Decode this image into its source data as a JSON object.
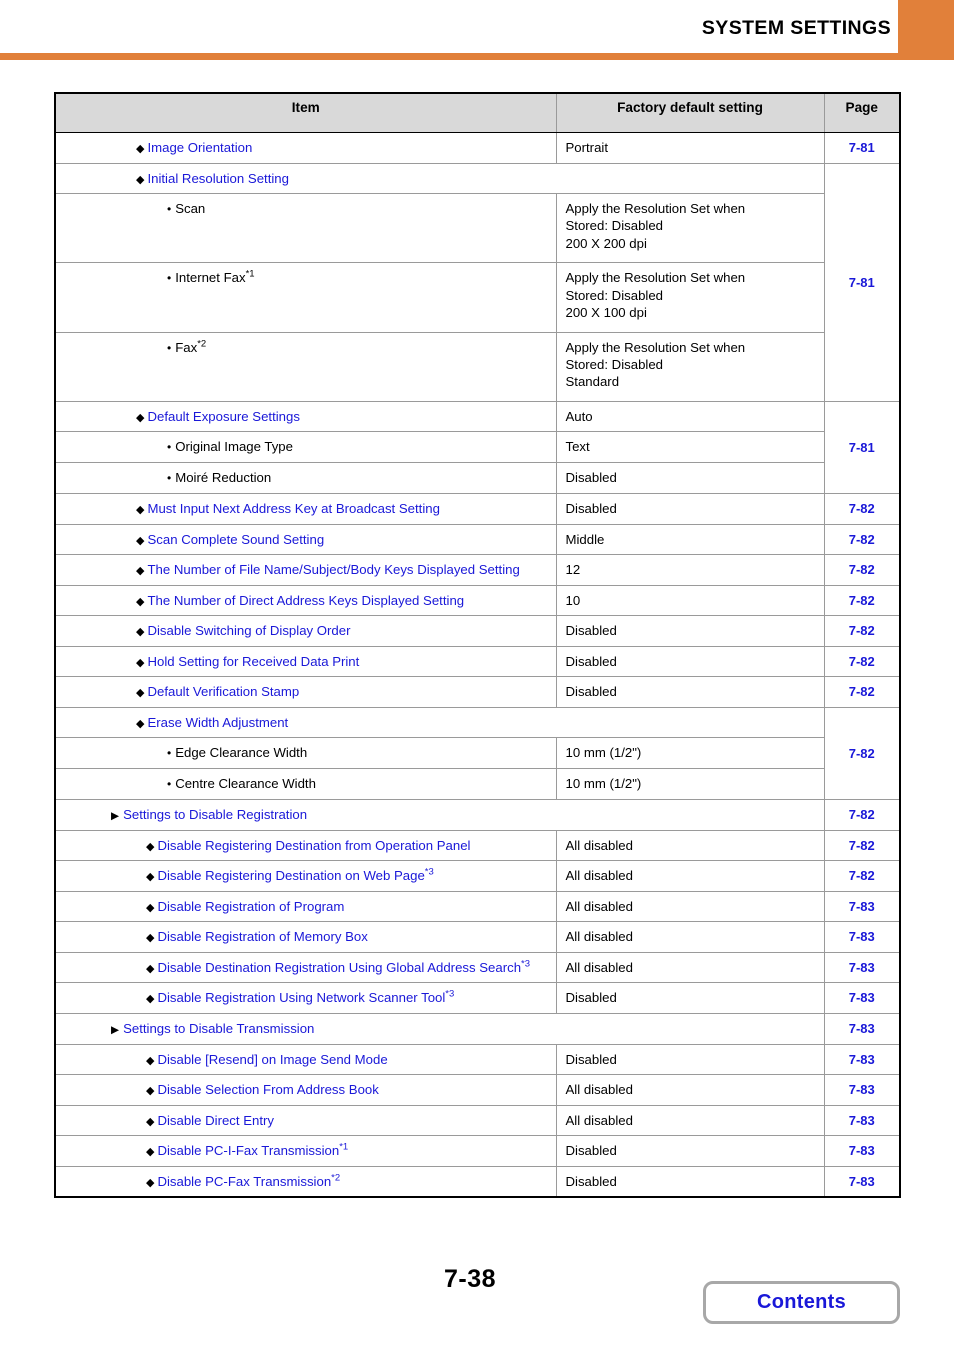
{
  "header": {
    "title": "SYSTEM SETTINGS",
    "accent_color": "#e1803a"
  },
  "table": {
    "columns": {
      "item": "Item",
      "factory_default": "Factory default setting",
      "page": "Page"
    },
    "link_color": "#1a18d8",
    "header_bg": "#d9d9d9",
    "rows": [
      {
        "level": "diamond",
        "label": "Image Orientation",
        "link": true,
        "default": [
          "Portrait"
        ],
        "page": "7-81"
      },
      {
        "level": "diamond",
        "label": "Initial Resolution Setting",
        "link": true,
        "spans_default": true,
        "default": [],
        "page": "7-81",
        "page_rowspan": 4
      },
      {
        "level": "bullet",
        "label": "Scan",
        "link": false,
        "default": [
          "Apply the Resolution Set when",
          "Stored: Disabled",
          "200 X 200 dpi"
        ],
        "page": null
      },
      {
        "level": "bullet",
        "label": "Internet Fax",
        "footnote": "*1",
        "link": false,
        "default": [
          "Apply the Resolution Set when",
          "Stored: Disabled",
          "200 X 100 dpi"
        ],
        "page": null
      },
      {
        "level": "bullet",
        "label": "Fax",
        "footnote": "*2",
        "link": false,
        "default": [
          "Apply the Resolution Set when",
          "Stored: Disabled",
          "Standard"
        ],
        "page": null
      },
      {
        "level": "diamond",
        "label": "Default Exposure Settings",
        "link": true,
        "default": [
          "Auto"
        ],
        "page": "7-81",
        "page_rowspan": 3
      },
      {
        "level": "bullet",
        "label": "Original Image Type",
        "link": false,
        "default": [
          "Text"
        ],
        "page": null
      },
      {
        "level": "bullet",
        "label": "Moiré Reduction",
        "link": false,
        "default": [
          "Disabled"
        ],
        "page": null
      },
      {
        "level": "diamond",
        "label": "Must Input Next Address Key at Broadcast Setting",
        "link": true,
        "default": [
          "Disabled"
        ],
        "page": "7-82"
      },
      {
        "level": "diamond",
        "label": "Scan Complete Sound Setting",
        "link": true,
        "default": [
          "Middle"
        ],
        "page": "7-82"
      },
      {
        "level": "diamond",
        "label": "The Number of File Name/Subject/Body Keys Displayed Setting",
        "link": true,
        "default": [
          "12"
        ],
        "page": "7-82"
      },
      {
        "level": "diamond",
        "label": "The Number of Direct Address Keys Displayed Setting",
        "link": true,
        "default": [
          "10"
        ],
        "page": "7-82"
      },
      {
        "level": "diamond",
        "label": "Disable Switching of Display Order",
        "link": true,
        "default": [
          "Disabled"
        ],
        "page": "7-82"
      },
      {
        "level": "diamond",
        "label": "Hold Setting for Received Data Print",
        "link": true,
        "default": [
          "Disabled"
        ],
        "page": "7-82"
      },
      {
        "level": "diamond",
        "label": "Default Verification Stamp",
        "link": true,
        "default": [
          "Disabled"
        ],
        "page": "7-82"
      },
      {
        "level": "diamond",
        "label": "Erase Width Adjustment",
        "link": true,
        "spans_default": true,
        "default": [],
        "page": "7-82",
        "page_rowspan": 3
      },
      {
        "level": "bullet",
        "label": "Edge Clearance Width",
        "link": false,
        "default": [
          "10 mm (1/2\")"
        ],
        "page": null
      },
      {
        "level": "bullet",
        "label": "Centre Clearance Width",
        "link": false,
        "default": [
          "10 mm (1/2\")"
        ],
        "page": null
      },
      {
        "level": "arrow",
        "label": "Settings to Disable Registration",
        "link": true,
        "spans_default": true,
        "default": [],
        "page": "7-82"
      },
      {
        "level": "diamond2",
        "label": "Disable Registering Destination from Operation Panel",
        "link": true,
        "default": [
          "All disabled"
        ],
        "page": "7-82"
      },
      {
        "level": "diamond2",
        "label": "Disable Registering Destination on Web Page",
        "footnote": "*3",
        "link": true,
        "default": [
          "All disabled"
        ],
        "page": "7-82"
      },
      {
        "level": "diamond2",
        "label": "Disable Registration of Program",
        "link": true,
        "default": [
          "All disabled"
        ],
        "page": "7-83"
      },
      {
        "level": "diamond2",
        "label": "Disable Registration of Memory Box",
        "link": true,
        "default": [
          "All disabled"
        ],
        "page": "7-83"
      },
      {
        "level": "diamond2",
        "label": "Disable Destination Registration Using Global Address Search",
        "footnote": "*3",
        "link": true,
        "default": [
          "All disabled"
        ],
        "page": "7-83"
      },
      {
        "level": "diamond2",
        "label": "Disable Registration Using Network Scanner Tool",
        "footnote": "*3",
        "link": true,
        "default": [
          "Disabled"
        ],
        "page": "7-83"
      },
      {
        "level": "arrow",
        "label": "Settings to Disable Transmission",
        "link": true,
        "spans_default": true,
        "default": [],
        "page": "7-83"
      },
      {
        "level": "diamond2",
        "label": "Disable [Resend] on Image Send Mode",
        "link": true,
        "default": [
          "Disabled"
        ],
        "page": "7-83"
      },
      {
        "level": "diamond2",
        "label": "Disable Selection From Address Book",
        "link": true,
        "default": [
          "All disabled"
        ],
        "page": "7-83"
      },
      {
        "level": "diamond2",
        "label": "Disable Direct Entry",
        "link": true,
        "default": [
          "All disabled"
        ],
        "page": "7-83"
      },
      {
        "level": "diamond2",
        "label": "Disable PC-I-Fax Transmission",
        "footnote": "*1",
        "link": true,
        "default": [
          "Disabled"
        ],
        "page": "7-83"
      },
      {
        "level": "diamond2",
        "label": "Disable PC-Fax Transmission",
        "footnote": "*2",
        "link": true,
        "default": [
          "Disabled"
        ],
        "page": "7-83"
      }
    ]
  },
  "footer": {
    "page_number": "7-38",
    "contents_label": "Contents"
  }
}
